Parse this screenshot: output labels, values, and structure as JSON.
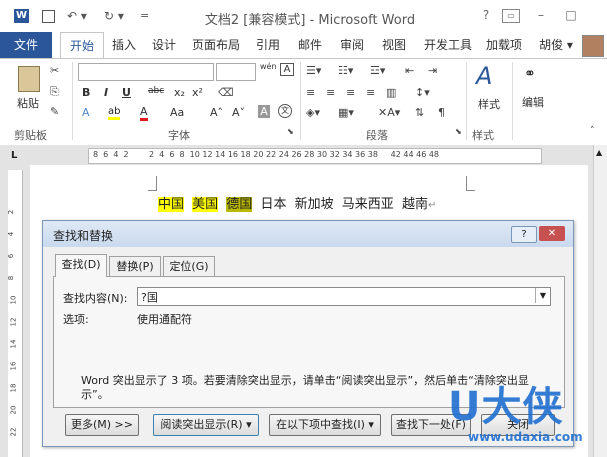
{
  "window": {
    "title": "文档2 [兼容模式] - Microsoft Word",
    "help": "?",
    "minimize": "–",
    "restore": "□"
  },
  "qat": {
    "undo": "↶ ▾",
    "redo": "↻ ▾"
  },
  "tabs": {
    "file": "文件",
    "home": "开始",
    "insert": "插入",
    "design": "设计",
    "layout": "页面布局",
    "references": "引用",
    "mailings": "邮件",
    "review": "审阅",
    "view": "视图",
    "developer": "开发工具",
    "addins": "加载项",
    "user": "胡俊 ▾"
  },
  "ribbon": {
    "paste": "粘贴",
    "clipboard": "剪贴板",
    "font_group": "字体",
    "paragraph_group": "段落",
    "styles_group": "样式",
    "styles_button": "样式",
    "edit_button": "编辑",
    "bold": "B",
    "italic": "I",
    "underline": "U",
    "strike": "abc",
    "sub": "x₂",
    "sup": "x²",
    "font_a": "A",
    "aa": "Aa",
    "grow": "A˄",
    "shrink": "A˅",
    "wen": "wén",
    "wen_char": "文"
  },
  "ruler": {
    "h_marks": "8  6  4  2        2  4  6  8  10 12 14 16 18 20 22 24 26 28 30 32 34 36 38     42 44 46 48",
    "v_marks": [
      "2",
      "4",
      "6",
      "8",
      "10",
      "12",
      "14",
      "16",
      "18",
      "20",
      "22"
    ]
  },
  "document": {
    "words": [
      {
        "text": "中国",
        "hl": "yellow"
      },
      {
        "text": "美国",
        "hl": "yellow"
      },
      {
        "text": "德国",
        "hl": "dark"
      },
      {
        "text": "日本",
        "hl": "none"
      },
      {
        "text": "新加坡",
        "hl": "none"
      },
      {
        "text": "马来西亚",
        "hl": "none"
      },
      {
        "text": "越南",
        "hl": "none"
      }
    ],
    "para_mark": "↵"
  },
  "dialog": {
    "title": "查找和替换",
    "help": "?",
    "close": "✕",
    "tabs": [
      "查找(D)",
      "替换(P)",
      "定位(G)"
    ],
    "find_label": "查找内容(N):",
    "find_value": "?国",
    "options_label": "选项:",
    "options_value": "使用通配符",
    "message": "Word 突出显示了 3 项。若要清除突出显示，请单击“阅读突出显示”，然后单击“清除突出显示”。",
    "buttons": {
      "more": "更多(M) >>",
      "reading_highlight": "阅读突出显示(R) ▾",
      "find_in": "在以下项中查找(I) ▾",
      "find_next": "查找下一处(F)",
      "close": "关闭"
    }
  },
  "watermark": {
    "brand": "U大侠",
    "url": "www.udaxia.com"
  }
}
